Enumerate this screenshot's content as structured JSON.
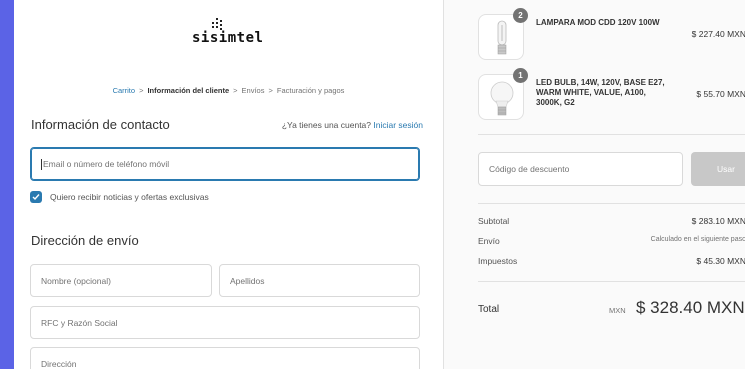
{
  "logo": {
    "text": "sisimtel"
  },
  "breadcrumb": {
    "items": [
      "Carrito",
      "Información del cliente",
      "Envíos",
      "Facturación y pagos"
    ],
    "separator": ">"
  },
  "contact": {
    "title": "Información de contacto",
    "account_question": "¿Ya tienes una cuenta?",
    "login_link": "Iniciar sesión",
    "email_placeholder": "Email o número de teléfono móvil",
    "newsletter_label": "Quiero recibir noticias y ofertas exclusivas",
    "newsletter_checked": true
  },
  "shipping": {
    "title": "Dirección de envío",
    "first_name_placeholder": "Nombre (opcional)",
    "last_name_placeholder": "Apellidos",
    "rfc_placeholder": "RFC y Razón Social",
    "address_placeholder": "Dirección"
  },
  "cart": {
    "items": [
      {
        "quantity": "2",
        "name": "LAMPARA MOD CDD 120V 100W",
        "price": "$ 227.40 MXN",
        "icon": "tubular-bulb-icon"
      },
      {
        "quantity": "1",
        "name": "LED BULB, 14W, 120V, BASE E27, WARM WHITE, VALUE, A100, 3000K, G2",
        "price": "$ 55.70 MXN",
        "icon": "led-bulb-icon"
      }
    ],
    "discount_placeholder": "Código de descuento",
    "apply_label": "Usar",
    "subtotal_label": "Subtotal",
    "subtotal_value": "$ 283.10 MXN",
    "shipping_label": "Envío",
    "shipping_value": "Calculado en el siguiente paso",
    "taxes_label": "Impuestos",
    "taxes_value": "$ 45.30 MXN",
    "total_label": "Total",
    "total_currency": "MXN",
    "total_value": "$ 328.40 MXN"
  },
  "colors": {
    "background": "#5b63e6",
    "accent": "#2a7ab0",
    "button_disabled": "#c8c8c8"
  }
}
